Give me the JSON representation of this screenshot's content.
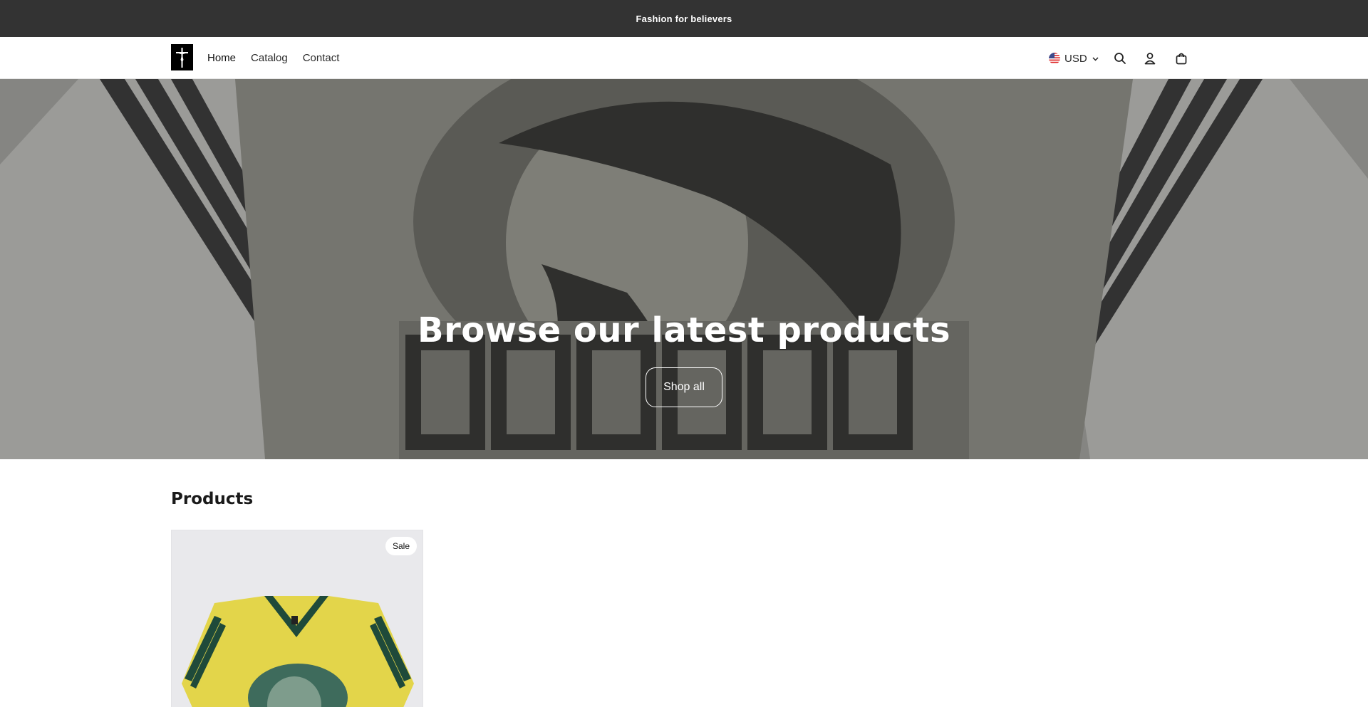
{
  "announcement": {
    "text": "Fashion for believers"
  },
  "header": {
    "nav": [
      {
        "label": "Home"
      },
      {
        "label": "Catalog"
      },
      {
        "label": "Contact"
      }
    ],
    "currency": {
      "label": "USD",
      "flag_icon": "us-flag-icon"
    },
    "icons": [
      "search-icon",
      "account-icon",
      "cart-icon"
    ]
  },
  "hero": {
    "title": "Browse our latest products",
    "button_label": "Shop all"
  },
  "products": {
    "heading": "Products",
    "items": [
      {
        "badge": "Sale"
      }
    ]
  },
  "colors": {
    "announcement_bg": "#333333",
    "hero_bg": "#9a9a95",
    "product_yellow": "#e6d84a",
    "product_green": "#1f4a3a"
  }
}
